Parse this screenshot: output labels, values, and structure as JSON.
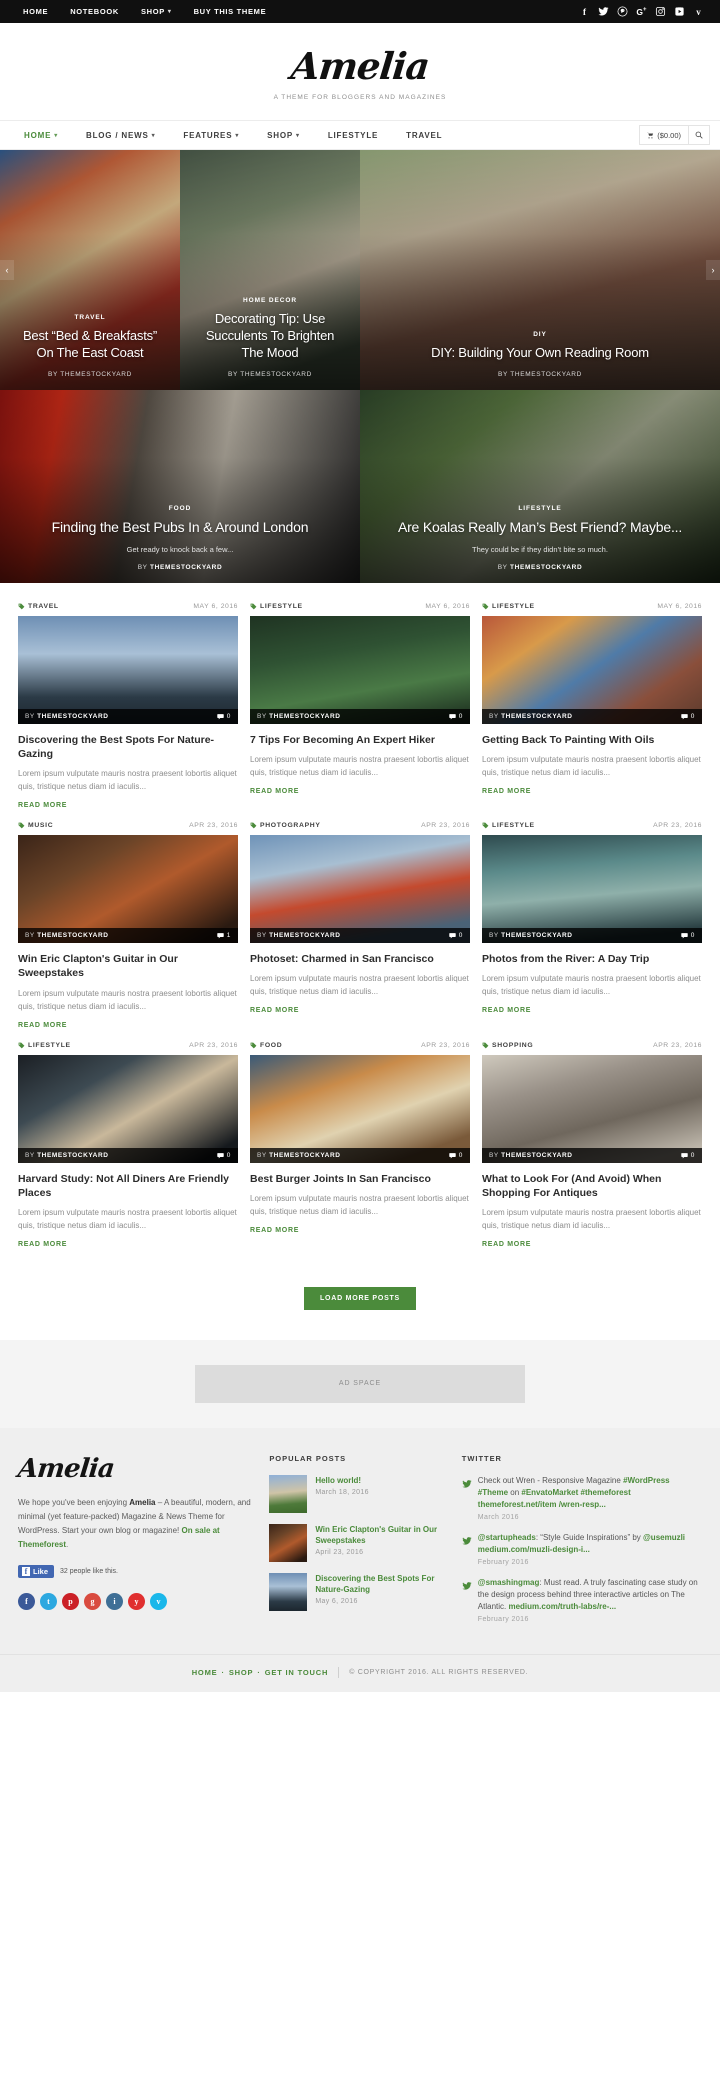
{
  "topbar": {
    "links": [
      {
        "label": "HOME",
        "caret": false
      },
      {
        "label": "NOTEBOOK",
        "caret": false
      },
      {
        "label": "SHOP",
        "caret": true
      },
      {
        "label": "BUY THIS THEME",
        "caret": false
      }
    ],
    "social": [
      "facebook-icon",
      "twitter-icon",
      "pinterest-icon",
      "google-plus-icon",
      "instagram-icon",
      "youtube-icon",
      "vimeo-icon"
    ]
  },
  "header": {
    "brand": "Amelia",
    "tagline": "A THEME FOR BLOGGERS AND MAGAZINES"
  },
  "mainnav": {
    "items": [
      {
        "label": "HOME",
        "caret": true,
        "active": true
      },
      {
        "label": "BLOG / NEWS",
        "caret": true,
        "active": false
      },
      {
        "label": "FEATURES",
        "caret": true,
        "active": false
      },
      {
        "label": "SHOP",
        "caret": true,
        "active": false
      },
      {
        "label": "LIFESTYLE",
        "caret": false,
        "active": false
      },
      {
        "label": "TRAVEL",
        "caret": false,
        "active": false
      }
    ],
    "cart_label": "($0.00)",
    "search_label": "search-icon"
  },
  "hero": {
    "row1": [
      {
        "category": "TRAVEL",
        "title": "Best “Bed & Breakfasts” On The East Coast",
        "author": "By themestockyard",
        "image": "img-waffle"
      },
      {
        "category": "HOME DECOR",
        "title": "Decorating Tip: Use Succulents To Brighten The Mood",
        "author": "By themestockyard",
        "image": "img-succ"
      },
      {
        "category": "DIY",
        "title": "DIY: Building Your Own Reading Room",
        "author": "By themestockyard",
        "image": "img-read"
      }
    ],
    "row2": [
      {
        "category": "FOOD",
        "title": "Finding the Best Pubs In & Around London",
        "excerpt": "Get ready to knock back a few...",
        "by_prefix": "BY ",
        "author": "THEMESTOCKYARD",
        "image": "img-pub"
      },
      {
        "category": "LIFESTYLE",
        "title": "Are Koalas Really Man’s Best Friend? Maybe...",
        "excerpt": "They could be if they didn’t bite so much.",
        "by_prefix": "BY ",
        "author": "THEMESTOCKYARD",
        "image": "img-koala"
      }
    ],
    "prev": "‹",
    "next": "›"
  },
  "grid": {
    "by_prefix": "BY ",
    "author": "THEMESTOCKYARD",
    "readmore": "READ MORE",
    "rows": [
      [
        {
          "category": "TRAVEL",
          "date": "MAY 6, 2016",
          "title": "Discovering the Best Spots For Nature-Gazing",
          "excerpt": "Lorem ipsum vulputate mauris nostra praesent lobortis aliquet quis, tristique netus diam id iaculis...",
          "comments": "0",
          "image": "img-forest",
          "show_readmore": true
        },
        {
          "category": "LIFESTYLE",
          "date": "MAY 6, 2016",
          "title": "7 Tips For Becoming An Expert Hiker",
          "excerpt": "Lorem ipsum vulputate mauris nostra praesent lobortis aliquet quis, tristique netus diam id iaculis...",
          "comments": "0",
          "image": "img-hiker",
          "show_readmore": true
        },
        {
          "category": "LIFESTYLE",
          "date": "MAY 6, 2016",
          "title": "Getting Back To Painting With Oils",
          "excerpt": "Lorem ipsum vulputate mauris nostra praesent lobortis aliquet quis, tristique netus diam id iaculis...",
          "comments": "0",
          "image": "img-paint",
          "show_readmore": true
        }
      ],
      [
        {
          "category": "MUSIC",
          "date": "APR 23, 2016",
          "title": "Win Eric Clapton's Guitar in Our Sweepstakes",
          "excerpt": "Lorem ipsum vulputate mauris nostra praesent lobortis aliquet quis, tristique netus diam id iaculis...",
          "comments": "1",
          "image": "img-guitar",
          "show_readmore": true
        },
        {
          "category": "PHOTOGRAPHY",
          "date": "APR 23, 2016",
          "title": "Photoset: Charmed in San Francisco",
          "excerpt": "Lorem ipsum vulputate mauris nostra praesent lobortis aliquet quis, tristique netus diam id iaculis...",
          "comments": "0",
          "image": "img-bridge",
          "show_readmore": true
        },
        {
          "category": "LIFESTYLE",
          "date": "APR 23, 2016",
          "title": "Photos from the River: A Day Trip",
          "excerpt": "Lorem ipsum vulputate mauris nostra praesent lobortis aliquet quis, tristique netus diam id iaculis...",
          "comments": "0",
          "image": "img-river",
          "show_readmore": true
        }
      ],
      [
        {
          "category": "LIFESTYLE",
          "date": "APR 23, 2016",
          "title": "Harvard Study: Not All Diners Are Friendly Places",
          "excerpt": "Lorem ipsum vulputate mauris nostra praesent lobortis aliquet quis, tristique netus diam id iaculis...",
          "comments": "0",
          "image": "img-diner",
          "show_readmore": true
        },
        {
          "category": "FOOD",
          "date": "APR 23, 2016",
          "title": "Best Burger Joints In San Francisco",
          "excerpt": "Lorem ipsum vulputate mauris nostra praesent lobortis aliquet quis, tristique netus diam id iaculis...",
          "comments": "0",
          "image": "img-burger",
          "show_readmore": true
        },
        {
          "category": "SHOPPING",
          "date": "APR 23, 2016",
          "title": "What to Look For (And Avoid) When Shopping For Antiques",
          "excerpt": "Lorem ipsum vulputate mauris nostra praesent lobortis aliquet quis, tristique netus diam id iaculis...",
          "comments": "0",
          "image": "img-antique",
          "show_readmore": true
        }
      ]
    ],
    "load_more": "LOAD MORE POSTS"
  },
  "ad": {
    "label": "AD SPACE"
  },
  "footer": {
    "brand": "Amelia",
    "about_pre": "We hope you've been enjoying ",
    "about_brand": "Amelia",
    "about_mid": " – A beautiful, modern, and minimal (yet feature-packed) Magazine & News Theme for WordPress. Start your own blog or magazine! ",
    "about_link": "On sale at Themeforest",
    "about_end": ".",
    "fb_like": "Like",
    "fb_count": "32 people like this.",
    "social": [
      {
        "name": "facebook-icon",
        "color": "#3b5998",
        "glyph": "f"
      },
      {
        "name": "twitter-icon",
        "color": "#2ca8e0",
        "glyph": "t"
      },
      {
        "name": "pinterest-icon",
        "color": "#cb2027",
        "glyph": "p"
      },
      {
        "name": "google-plus-icon",
        "color": "#d94b3f",
        "glyph": "g"
      },
      {
        "name": "instagram-icon",
        "color": "#3f6f96",
        "glyph": "i"
      },
      {
        "name": "youtube-icon",
        "color": "#e02f2f",
        "glyph": "y"
      },
      {
        "name": "vimeo-icon",
        "color": "#1ab7ea",
        "glyph": "v"
      }
    ],
    "popular_title": "POPULAR POSTS",
    "popular": [
      {
        "title": "Hello world!",
        "date": "March 18, 2016",
        "image": "img-hello"
      },
      {
        "title": "Win Eric Clapton's Guitar in Our Sweepstakes",
        "date": "April 23, 2016",
        "image": "img-guitar"
      },
      {
        "title": "Discovering the Best Spots For Nature-Gazing",
        "date": "May 6, 2016",
        "image": "img-forest"
      }
    ],
    "twitter_title": "TWITTER",
    "tweets": [
      {
        "plain1": "Check out Wren - Responsive Magazine ",
        "link1": "#WordPress #Theme",
        "plain2": " on ",
        "link2": "#EnvatoMarket #themeforest themeforest.net/item /wren-resp...",
        "date": "March 2016"
      },
      {
        "plain1": "",
        "link1": "@startupheads",
        "plain2": ": “Style Guide Inspirations” by ",
        "link2": "@usemuzli medium.com/muzli-design-i...",
        "date": "February 2016"
      },
      {
        "plain1": "",
        "link1": "@smashingmag",
        "plain2": ": Must read. A truly fascinating case study on the design process behind three interactive articles on The Atlantic. ",
        "link2": "medium.com/truth-labs/re-...",
        "date": "February 2016"
      }
    ],
    "bottom_nav": [
      "HOME",
      "SHOP",
      "GET IN TOUCH"
    ],
    "bottom_sep": "·",
    "copyright": "© COPYRIGHT 2016. ALL RIGHTS RESERVED."
  }
}
